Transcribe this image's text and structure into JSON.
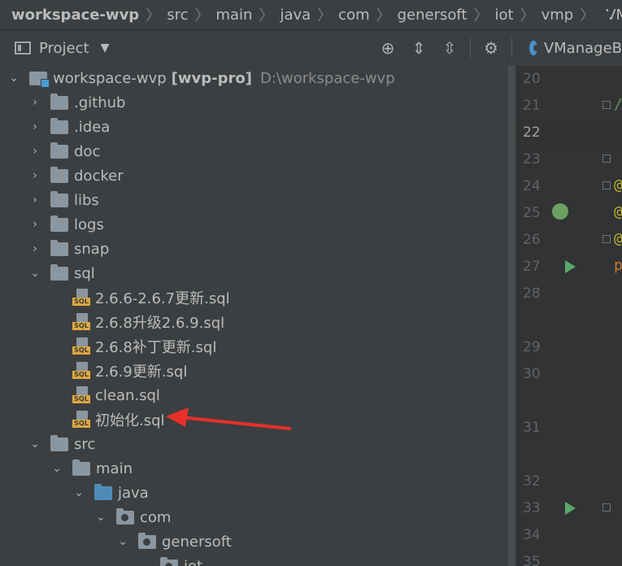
{
  "breadcrumb": {
    "items": [
      "workspace-wvp",
      "src",
      "main",
      "java",
      "com",
      "genersoft",
      "iot",
      "vmp",
      "VManageBoo"
    ]
  },
  "project_panel": {
    "title": "Project",
    "toolbar": [
      "locate-icon",
      "expand-all-icon",
      "collapse-all-icon",
      "settings-icon"
    ]
  },
  "tree": {
    "root": {
      "name": "workspace-wvp",
      "module": "[wvp-pro]",
      "path": "D:\\workspace-wvp"
    },
    "folders": [
      ".github",
      ".idea",
      "doc",
      "docker",
      "libs",
      "logs",
      "snap"
    ],
    "sql_folder": "sql",
    "sql_files": [
      "2.6.6-2.6.7更新.sql",
      "2.6.8升级2.6.9.sql",
      "2.6.8补丁更新.sql",
      "2.6.9更新.sql",
      "clean.sql",
      "初始化.sql"
    ],
    "sql_icon_text": "SQL",
    "src_chain": [
      "src",
      "main",
      "java",
      "com",
      "genersoft",
      "iot"
    ]
  },
  "editor": {
    "tab_label": "VManageB",
    "line_numbers": [
      "20",
      "21",
      "22",
      "23",
      "24",
      "25",
      "26",
      "27",
      "28",
      "29",
      "30",
      "31",
      "32",
      "33",
      "34",
      "35"
    ],
    "code_fragments": {
      "l21": "/",
      "l24": "@",
      "l25": "@",
      "l26": "@",
      "l27": "p"
    }
  },
  "colors": {
    "annotation_arrow": "#e8302a",
    "sql_badge": "#e0a83e",
    "run_icon": "#59a869"
  }
}
